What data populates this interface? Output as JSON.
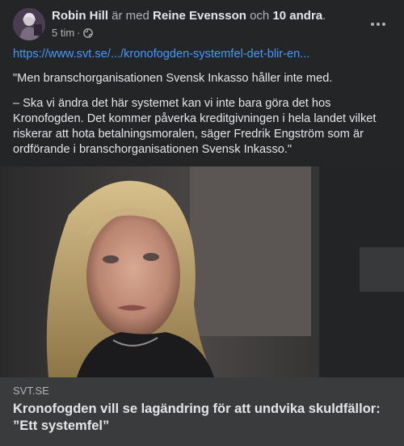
{
  "post": {
    "author": "Robin Hill",
    "with_text": "är med",
    "tagged": "Reine Evensson",
    "and_text": "och",
    "others": "10 andra",
    "period": ".",
    "time": "5 tim",
    "meta_separator": "·",
    "privacy_icon": "globe-icon",
    "more_icon": "more-options-icon"
  },
  "body": {
    "link": "https://www.svt.se/.../kronofogden-systemfel-det-blir-en...",
    "paragraph1": "\"Men branschorganisationen Svensk Inkasso håller inte med.",
    "paragraph2": "– Ska vi ändra det här systemet kan vi inte bara göra det hos Kronofogden. Det kommer påverka kreditgivningen i hela landet vilket riskerar att hota betalningsmoralen, säger Fredrik Engström som är ordförande i branschorganisationen Svensk Inkasso.\""
  },
  "link_preview": {
    "domain": "SVT.SE",
    "title": "Kronofogden vill se lagändring för att undvika skuldfällor: ”Ett systemfel”"
  },
  "colors": {
    "background": "#242526",
    "text": "#e4e6eb",
    "muted": "#b0b3b8",
    "link": "#4599ff",
    "preview_bg": "#3a3b3c"
  }
}
